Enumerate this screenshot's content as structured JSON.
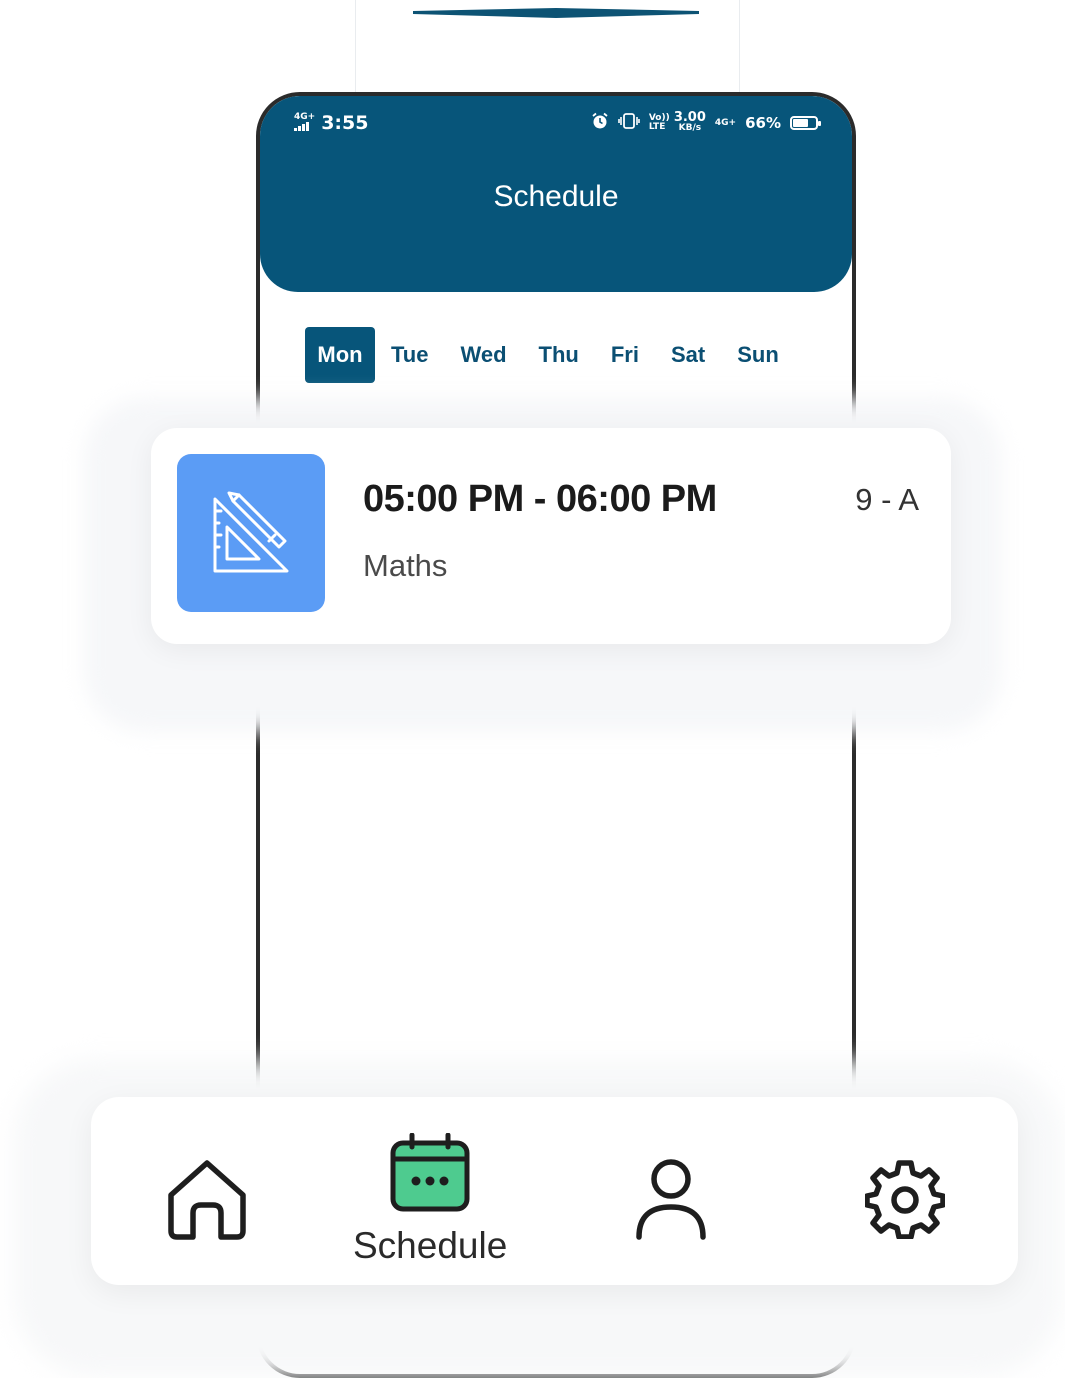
{
  "status_bar": {
    "time": "3:55",
    "signal_left": "4G+",
    "volte": "Vo)) LTE",
    "net_speed": "3.00",
    "net_unit": "KB/s",
    "signal_right": "4G+",
    "battery_percent": "66%",
    "battery_level": 0.66
  },
  "header": {
    "title": "Schedule"
  },
  "days": {
    "selected": "Mon",
    "items": [
      "Mon",
      "Tue",
      "Wed",
      "Thu",
      "Fri",
      "Sat",
      "Sun"
    ]
  },
  "schedule": [
    {
      "time_range": "05:00 PM - 06:00 PM",
      "subject": "Maths",
      "class": "9 - A",
      "icon": "geometry-tools-icon",
      "icon_bg": "#5b9cf5"
    }
  ],
  "bottom_nav": {
    "active": "Schedule",
    "items": [
      {
        "icon": "home-icon",
        "label": ""
      },
      {
        "icon": "calendar-icon",
        "label": "Schedule"
      },
      {
        "icon": "profile-icon",
        "label": ""
      },
      {
        "icon": "gear-icon",
        "label": ""
      }
    ]
  },
  "colors": {
    "primary": "#07557a",
    "accent_green": "#4ecb8f",
    "card_icon_blue": "#5b9cf5"
  }
}
